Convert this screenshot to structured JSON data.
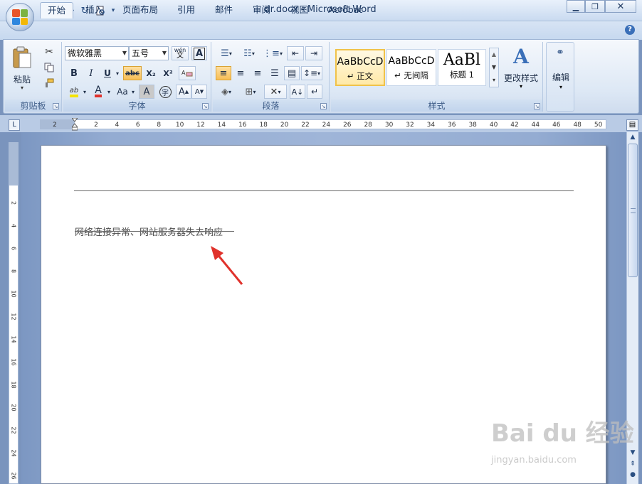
{
  "window": {
    "title": "dr.docx - Microsoft Word",
    "minimize_icon": "minimize-icon",
    "maximize_icon": "maximize-icon",
    "close_icon": "close-icon"
  },
  "quick_access": {
    "items": [
      "save-icon",
      "undo-icon",
      "dropdown-icon",
      "redo-icon",
      "print-preview-icon",
      "customize-icon"
    ]
  },
  "tabs": [
    {
      "label": "开始",
      "active": true
    },
    {
      "label": "插入"
    },
    {
      "label": "页面布局"
    },
    {
      "label": "引用"
    },
    {
      "label": "邮件"
    },
    {
      "label": "审阅"
    },
    {
      "label": "视图"
    },
    {
      "label": "Acrobat"
    }
  ],
  "ribbon": {
    "clipboard": {
      "label": "剪贴板",
      "paste_label": "粘贴"
    },
    "font": {
      "label": "字体",
      "font_name": "微软雅黑",
      "font_size": "五号",
      "phonetic_label": "wén",
      "bold": "B",
      "italic": "I",
      "underline": "U",
      "strikethrough": "abc",
      "subscript": "X₂",
      "superscript": "X²",
      "grow": "A",
      "shrink": "A",
      "change_case": "Aa",
      "char_shading": "A",
      "enclose": "字"
    },
    "paragraph": {
      "label": "段落"
    },
    "styles": {
      "label": "样式",
      "items": [
        {
          "sample": "AaBbCcD",
          "name": "↵ 正文"
        },
        {
          "sample": "AaBbCcD",
          "name": "↵ 无间隔"
        },
        {
          "sample": "AaBl",
          "name": "标题 1"
        }
      ],
      "change_styles": "更改样式"
    },
    "editing": {
      "label": "编辑"
    }
  },
  "ruler": {
    "numbers": [
      "2",
      "2",
      "4",
      "6",
      "8",
      "10",
      "12",
      "14",
      "16",
      "18",
      "20",
      "22",
      "24",
      "26",
      "28",
      "30",
      "32",
      "34",
      "36",
      "38",
      "40",
      "42",
      "44",
      "46",
      "48",
      "50"
    ],
    "vertical_numbers": [
      "2",
      "4",
      "6",
      "8",
      "10",
      "12",
      "14",
      "16",
      "18",
      "20",
      "22",
      "24",
      "26"
    ]
  },
  "document": {
    "text": "网络连接异常、网站服务器失去响应"
  },
  "watermark": {
    "main": "Bai du 经验",
    "sub": "jingyan.baidu.com"
  },
  "colors": {
    "arrow": "#e0322c",
    "highlight": "#f5e400",
    "font_color": "#e0322c"
  }
}
